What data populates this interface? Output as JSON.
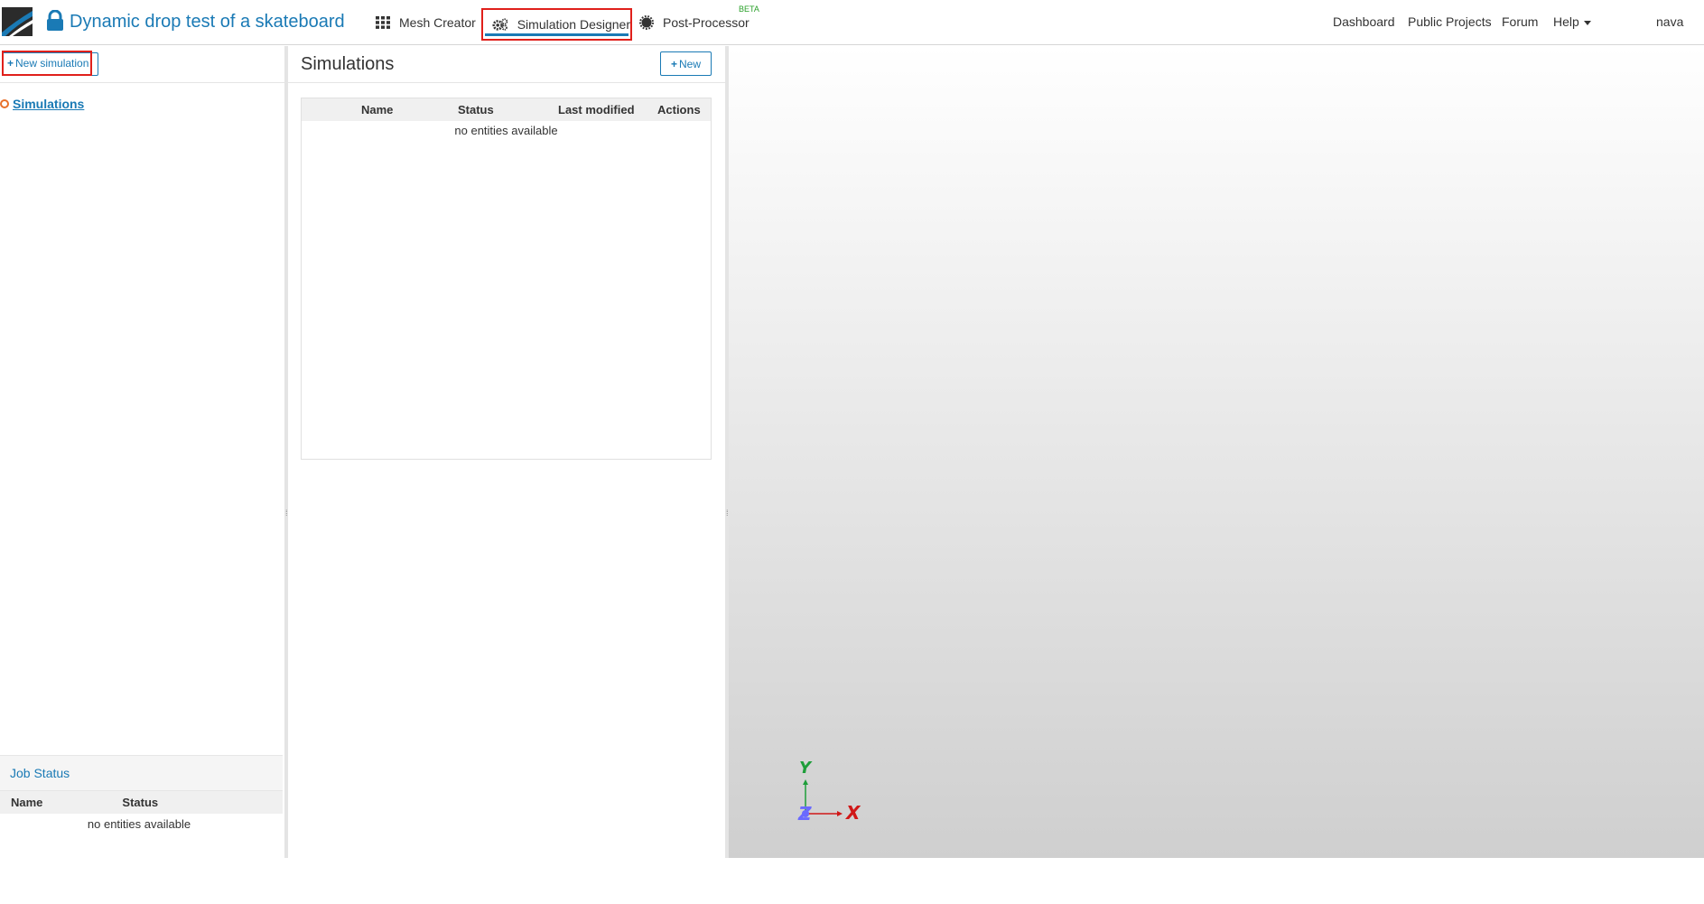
{
  "header": {
    "project_title": "Dynamic drop test of a skateboard",
    "tabs": [
      {
        "label": "Mesh Creator",
        "icon": "grid-icon"
      },
      {
        "label": "Simulation Designer",
        "icon": "gears-icon",
        "active": true
      },
      {
        "label": "Post-Processor",
        "icon": "gear-icon",
        "badge": "BETA"
      }
    ],
    "right_nav": {
      "dashboard": "Dashboard",
      "public_projects": "Public Projects",
      "forum": "Forum",
      "help": "Help",
      "user": "nava"
    }
  },
  "left_panel": {
    "new_simulation_label": "New simulation",
    "tree_root_label": "Simulations",
    "job_status": {
      "title": "Job Status",
      "columns": [
        "Name",
        "Status"
      ],
      "empty_text": "no entities available"
    }
  },
  "middle_panel": {
    "title": "Simulations",
    "new_label": "New",
    "table": {
      "columns": [
        "Name",
        "Status",
        "Last modified",
        "Actions"
      ],
      "empty_text": "no entities available"
    }
  },
  "viewport": {
    "axes": {
      "x": "X",
      "y": "Y",
      "z": "Z"
    }
  },
  "colors": {
    "accent": "#1a7ab5",
    "highlight_border": "#e0201b",
    "beta": "#2aa02a",
    "tree_marker": "#e8702a"
  }
}
